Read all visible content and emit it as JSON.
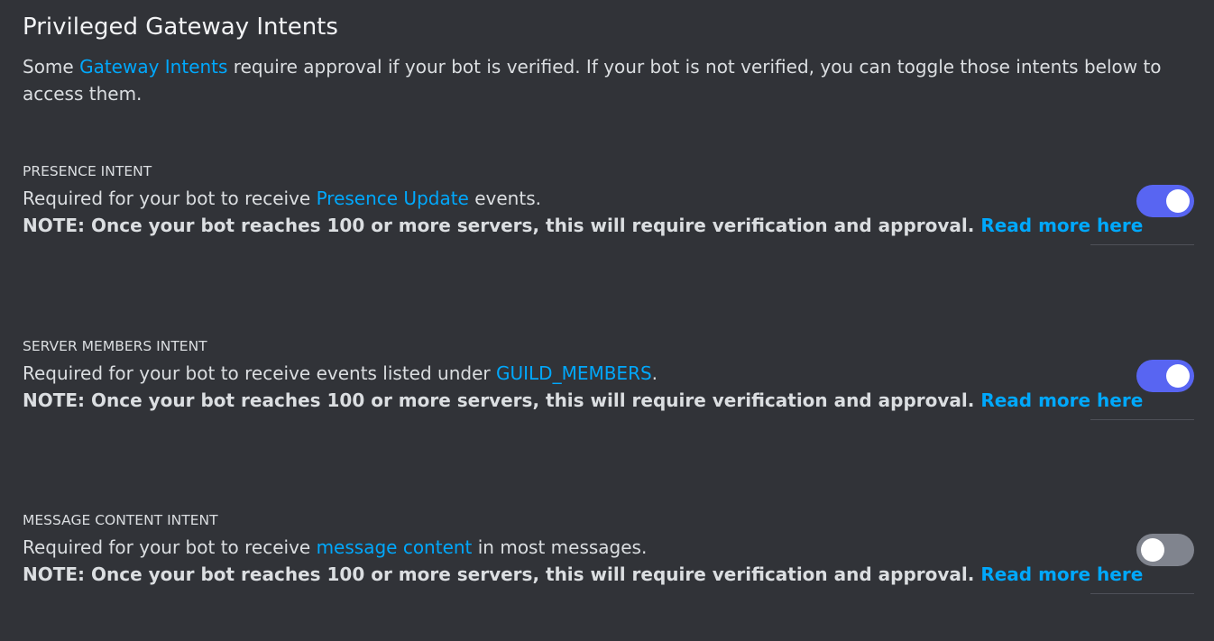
{
  "header": {
    "title": "Privileged Gateway Intents",
    "intro_before": "Some ",
    "intro_link": "Gateway Intents",
    "intro_after": " require approval if your bot is verified. If your bot is not verified, you can toggle those intents below to access them."
  },
  "intents": [
    {
      "title": "PRESENCE INTENT",
      "desc_before": "Required for your bot to receive ",
      "desc_link": "Presence Update",
      "desc_after": " events.",
      "note": "NOTE: Once your bot reaches 100 or more servers, this will require verification and approval. ",
      "read_more": "Read more here",
      "enabled": true
    },
    {
      "title": "SERVER MEMBERS INTENT",
      "desc_before": "Required for your bot to receive events listed under ",
      "desc_link": "GUILD_MEMBERS",
      "desc_after": ".",
      "note": "NOTE: Once your bot reaches 100 or more servers, this will require verification and approval. ",
      "read_more": "Read more here",
      "enabled": true
    },
    {
      "title": "MESSAGE CONTENT INTENT",
      "desc_before": "Required for your bot to receive ",
      "desc_link": "message content",
      "desc_after": " in most messages.",
      "note": "NOTE: Once your bot reaches 100 or more servers, this will require verification and approval. ",
      "read_more": "Read more here",
      "enabled": false
    }
  ],
  "colors": {
    "background": "#313338",
    "link": "#00a8fc",
    "toggle_on": "#5865f2",
    "toggle_off": "#80848e"
  }
}
